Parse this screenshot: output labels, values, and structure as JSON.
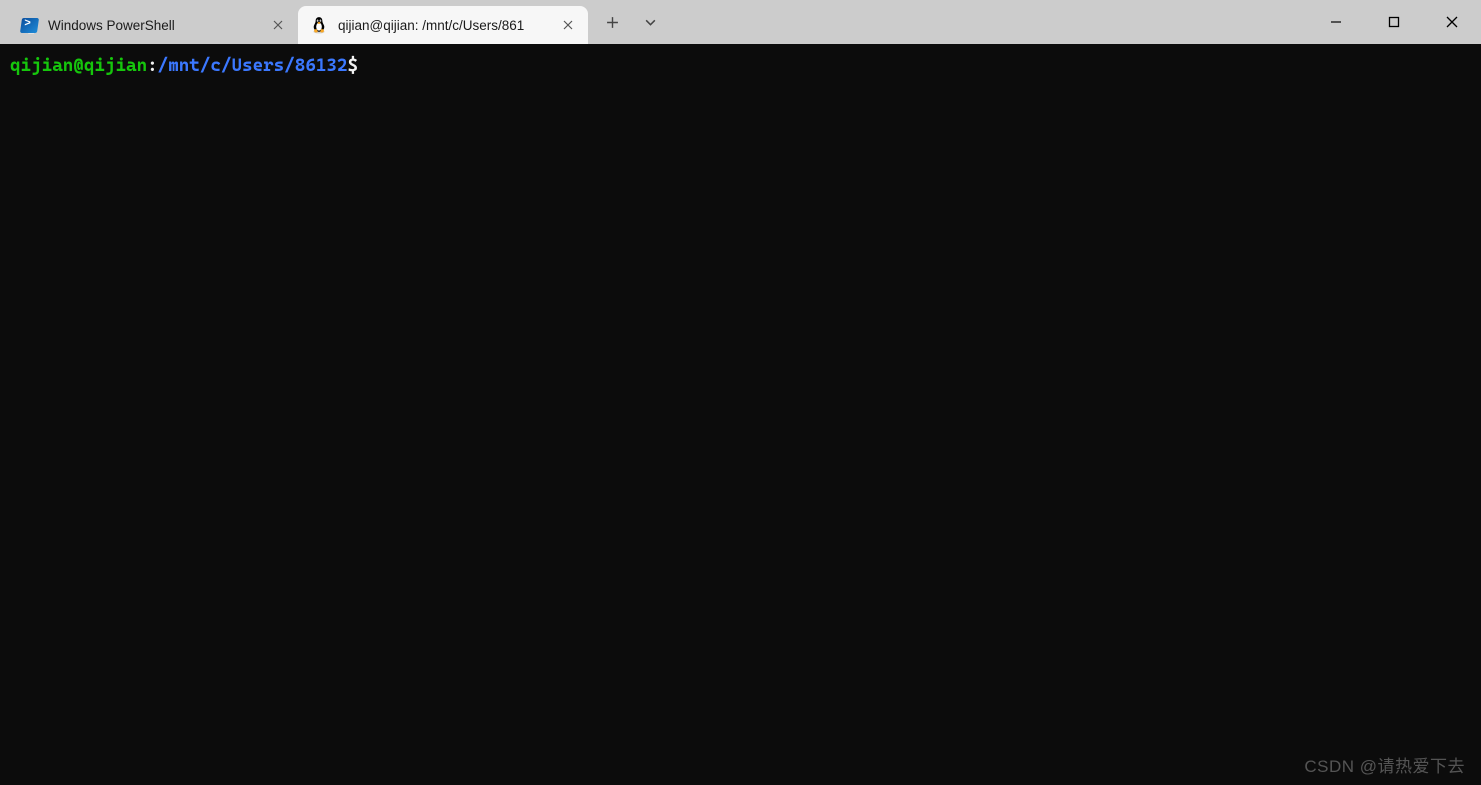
{
  "tabs": [
    {
      "title": "Windows PowerShell",
      "icon": "powershell-icon",
      "active": false
    },
    {
      "title": "qijian@qijian: /mnt/c/Users/861",
      "icon": "tux-icon",
      "active": true
    }
  ],
  "prompt": {
    "user_host": "qijian@qijian",
    "sep": ":",
    "path": "/mnt/c/Users/86132",
    "symbol": "$"
  },
  "watermark": "CSDN @请热爱下去"
}
